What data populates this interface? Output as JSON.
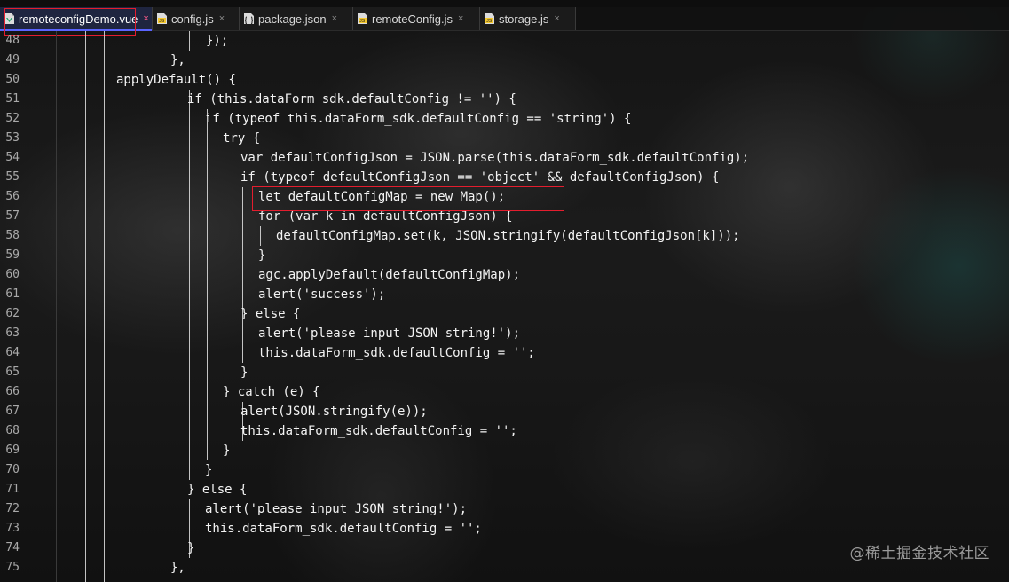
{
  "tabs": [
    {
      "label": "remoteconfigDemo.vue",
      "close": "×",
      "icon": "vue-file-icon",
      "active": true
    },
    {
      "label": "config.js",
      "close": "×",
      "icon": "js-file-icon",
      "active": false
    },
    {
      "label": "package.json",
      "close": "×",
      "icon": "json-file-icon",
      "active": false
    },
    {
      "label": "remoteConfig.js",
      "close": "×",
      "icon": "js-file-icon",
      "active": false
    },
    {
      "label": "storage.js",
      "close": "×",
      "icon": "js-file-icon",
      "active": false
    }
  ],
  "editor": {
    "lines": [
      {
        "number": "48",
        "code": "});"
      },
      {
        "number": "49",
        "code": "},"
      },
      {
        "number": "50",
        "code": "applyDefault() {"
      },
      {
        "number": "51",
        "code": "if (this.dataForm_sdk.defaultConfig != '') {"
      },
      {
        "number": "52",
        "code": "if (typeof this.dataForm_sdk.defaultConfig == 'string') {"
      },
      {
        "number": "53",
        "code": "try {"
      },
      {
        "number": "54",
        "code": "var defaultConfigJson = JSON.parse(this.dataForm_sdk.defaultConfig);"
      },
      {
        "number": "55",
        "code": "if (typeof defaultConfigJson == 'object' && defaultConfigJson) {"
      },
      {
        "number": "56",
        "code": "let defaultConfigMap = new Map();"
      },
      {
        "number": "57",
        "code": "for (var k in defaultConfigJson) {"
      },
      {
        "number": "58",
        "code": "defaultConfigMap.set(k, JSON.stringify(defaultConfigJson[k]));"
      },
      {
        "number": "59",
        "code": "}"
      },
      {
        "number": "60",
        "code": "agc.applyDefault(defaultConfigMap);"
      },
      {
        "number": "61",
        "code": "alert('success');"
      },
      {
        "number": "62",
        "code": "} else {"
      },
      {
        "number": "63",
        "code": "alert('please input JSON string!');"
      },
      {
        "number": "64",
        "code": "this.dataForm_sdk.defaultConfig = '';"
      },
      {
        "number": "65",
        "code": "}"
      },
      {
        "number": "66",
        "code": "} catch (e) {"
      },
      {
        "number": "67",
        "code": "alert(JSON.stringify(e));"
      },
      {
        "number": "68",
        "code": "this.dataForm_sdk.defaultConfig = '';"
      },
      {
        "number": "69",
        "code": "}"
      },
      {
        "number": "70",
        "code": "}"
      },
      {
        "number": "71",
        "code": "} else {"
      },
      {
        "number": "72",
        "code": "alert('please input JSON string!');"
      },
      {
        "number": "73",
        "code": "this.dataForm_sdk.defaultConfig = '';"
      },
      {
        "number": "74",
        "code": "}"
      },
      {
        "number": "75",
        "code": "},"
      }
    ]
  },
  "watermark": "@稀土掘金技术社区",
  "colors": {
    "active_tab": "#1f2540",
    "tab_accent": "#5a64ff",
    "annotation_red": "#e41d2e",
    "code_text": "#f3f3f3",
    "line_number": "#a9a9a9"
  }
}
